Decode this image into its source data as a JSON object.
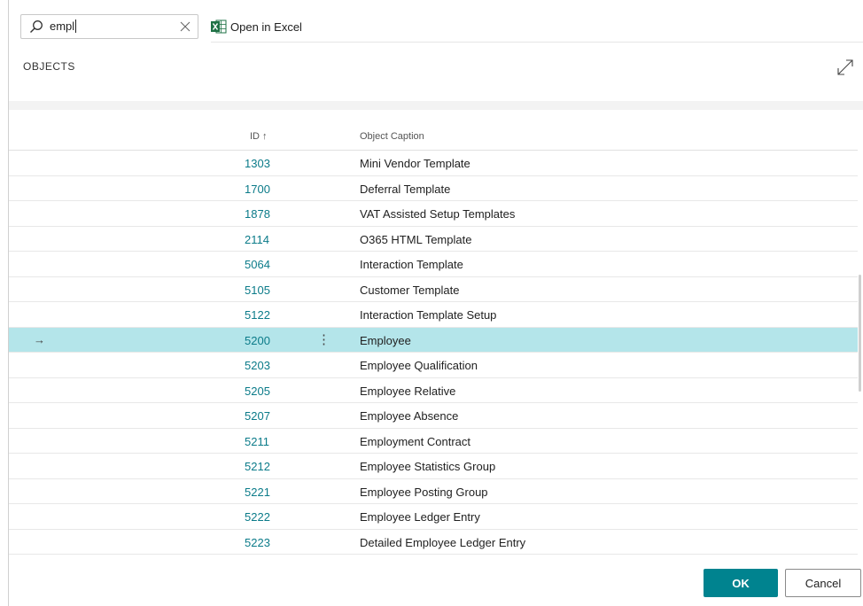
{
  "search": {
    "value": "empl",
    "icon": "search-icon",
    "clear_icon": "close-icon"
  },
  "toolbar": {
    "excel_label": "Open in Excel",
    "excel_icon": "excel-icon"
  },
  "section": {
    "title": "OBJECTS",
    "expand_icon": "expand-icon"
  },
  "grid": {
    "columns": {
      "id": "ID ↑",
      "caption": "Object Caption"
    },
    "rows": [
      {
        "id": "1303",
        "caption": "Mini Vendor Template"
      },
      {
        "id": "1700",
        "caption": "Deferral Template"
      },
      {
        "id": "1878",
        "caption": "VAT Assisted Setup Templates"
      },
      {
        "id": "2114",
        "caption": "O365 HTML Template"
      },
      {
        "id": "5064",
        "caption": "Interaction Template"
      },
      {
        "id": "5105",
        "caption": "Customer Template"
      },
      {
        "id": "5122",
        "caption": "Interaction Template Setup"
      },
      {
        "id": "5200",
        "caption": "Employee",
        "selected": true,
        "arrow": "→",
        "menu": "⋮"
      },
      {
        "id": "5203",
        "caption": "Employee Qualification"
      },
      {
        "id": "5205",
        "caption": "Employee Relative"
      },
      {
        "id": "5207",
        "caption": "Employee Absence"
      },
      {
        "id": "5211",
        "caption": "Employment Contract"
      },
      {
        "id": "5212",
        "caption": "Employee Statistics Group"
      },
      {
        "id": "5221",
        "caption": "Employee Posting Group"
      },
      {
        "id": "5222",
        "caption": "Employee Ledger Entry"
      },
      {
        "id": "5223",
        "caption": "Detailed Employee Ledger Entry"
      }
    ]
  },
  "buttons": {
    "ok": "OK",
    "cancel": "Cancel"
  },
  "colors": {
    "accent": "#00838f",
    "link": "#0b7b89",
    "selected_row": "#b4e5ea",
    "excel_green": "#1e7145"
  }
}
